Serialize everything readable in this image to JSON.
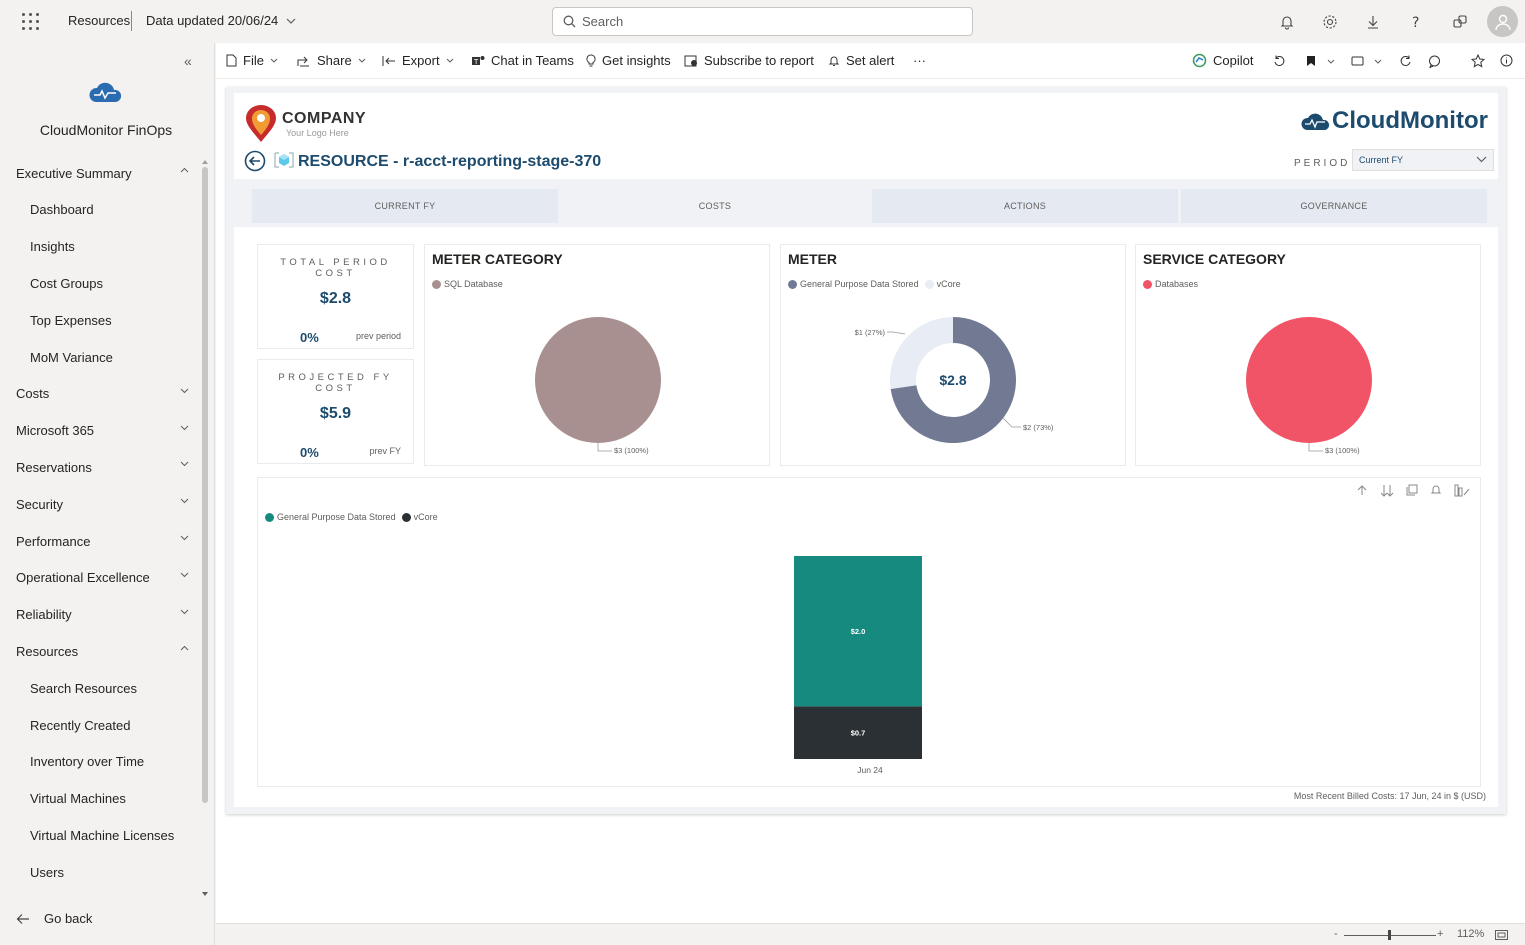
{
  "topbar": {
    "breadcrumb_resources": "Resources",
    "data_updated": "Data updated 20/06/24",
    "search_placeholder": "Search"
  },
  "sidebar": {
    "title": "CloudMonitor FinOps",
    "items": [
      {
        "label": "Executive Summary",
        "level": 0,
        "chevron": "up"
      },
      {
        "label": "Dashboard",
        "level": 1
      },
      {
        "label": "Insights",
        "level": 1
      },
      {
        "label": "Cost Groups",
        "level": 1
      },
      {
        "label": "Top Expenses",
        "level": 1
      },
      {
        "label": "MoM Variance",
        "level": 1
      },
      {
        "label": "Costs",
        "level": 0,
        "chevron": "down"
      },
      {
        "label": "Microsoft 365",
        "level": 0,
        "chevron": "down"
      },
      {
        "label": "Reservations",
        "level": 0,
        "chevron": "down"
      },
      {
        "label": "Security",
        "level": 0,
        "chevron": "down"
      },
      {
        "label": "Performance",
        "level": 0,
        "chevron": "down"
      },
      {
        "label": "Operational Excellence",
        "level": 0,
        "chevron": "down"
      },
      {
        "label": "Reliability",
        "level": 0,
        "chevron": "down"
      },
      {
        "label": "Resources",
        "level": 0,
        "chevron": "up"
      },
      {
        "label": "Search Resources",
        "level": 1
      },
      {
        "label": "Recently Created",
        "level": 1
      },
      {
        "label": "Inventory over Time",
        "level": 1
      },
      {
        "label": "Virtual Machines",
        "level": 1
      },
      {
        "label": "Virtual Machine Licenses",
        "level": 1
      },
      {
        "label": "Users",
        "level": 1
      }
    ],
    "go_back": "Go back"
  },
  "cmdbar": {
    "file": "File",
    "share": "Share",
    "export": "Export",
    "chat_in_teams": "Chat in Teams",
    "get_insights": "Get insights",
    "subscribe": "Subscribe to report",
    "set_alert": "Set alert",
    "more": "···",
    "copilot": "Copilot"
  },
  "report": {
    "company_name": "COMPANY",
    "company_sub": "Your Logo Here",
    "resource_title": "RESOURCE - r-acct-reporting-stage-370",
    "brand": "CloudMonitor",
    "period_label": "PERIOD",
    "period_value": "Current FY",
    "tabs": [
      "CURRENT FY",
      "COSTS",
      "ACTIONS",
      "GOVERNANCE"
    ],
    "active_tab": 1,
    "kpi_total": {
      "title": "TOTAL PERIOD COST",
      "value": "$2.8",
      "pct": "0%",
      "cmp": "prev period"
    },
    "kpi_projected": {
      "title": "PROJECTED FY COST",
      "value": "$5.9",
      "pct": "0%",
      "cmp": "prev FY"
    },
    "footer_note": "Most Recent Billed Costs: 17 Jun, 24 in $ (USD)"
  },
  "colors": {
    "navy": "#1c4b6e",
    "sql": "#a89090",
    "meter_general": "#717a92",
    "meter_vcore": "#e8ecf4",
    "databases": "#f15467",
    "teal": "#178a80",
    "dark": "#2b3034"
  },
  "chart_data": [
    {
      "type": "pie",
      "title": "METER CATEGORY",
      "categories": [
        "SQL Database"
      ],
      "values": [
        3
      ],
      "data_labels": [
        "$3 (100%)"
      ]
    },
    {
      "type": "pie",
      "title": "METER",
      "categories": [
        "General Purpose Data Stored",
        "vCore"
      ],
      "values": [
        2,
        1
      ],
      "data_labels": [
        "$2 (73%)",
        "$1 (27%)"
      ],
      "center_label": "$2.8",
      "donut": true
    },
    {
      "type": "pie",
      "title": "SERVICE CATEGORY",
      "categories": [
        "Databases"
      ],
      "values": [
        3
      ],
      "data_labels": [
        "$3 (100%)"
      ]
    },
    {
      "type": "bar",
      "stacked": true,
      "categories": [
        "Jun 24"
      ],
      "series": [
        {
          "name": "General Purpose Data Stored",
          "values": [
            2.0
          ],
          "label": "$2.0"
        },
        {
          "name": "vCore",
          "values": [
            0.7
          ],
          "label": "$0.7"
        }
      ]
    }
  ],
  "statusbar": {
    "zoom": "112%",
    "minus": "-",
    "plus": "+"
  }
}
